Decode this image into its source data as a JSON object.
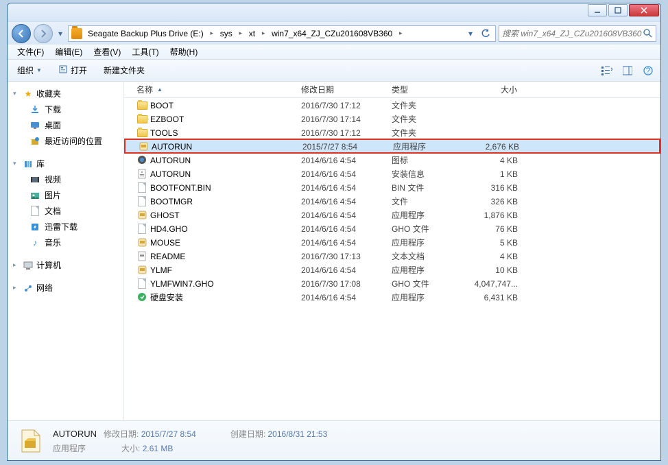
{
  "breadcrumbs": [
    "Seagate Backup Plus Drive (E:)",
    "sys",
    "xt",
    "win7_x64_ZJ_CZu201608VB360"
  ],
  "search_placeholder": "搜索 win7_x64_ZJ_CZu201608VB360",
  "menu": {
    "file": "文件(F)",
    "edit": "编辑(E)",
    "view": "查看(V)",
    "tools": "工具(T)",
    "help": "帮助(H)"
  },
  "toolbar": {
    "organize": "组织",
    "open": "打开",
    "newfolder": "新建文件夹"
  },
  "columns": {
    "name": "名称",
    "date": "修改日期",
    "type": "类型",
    "size": "大小"
  },
  "sidebar": {
    "fav": {
      "label": "收藏夹",
      "items": [
        "下载",
        "桌面",
        "最近访问的位置"
      ]
    },
    "lib": {
      "label": "库",
      "items": [
        "视频",
        "图片",
        "文档",
        "迅雷下载",
        "音乐"
      ]
    },
    "computer": "计算机",
    "network": "网络"
  },
  "files": [
    {
      "icon": "folder",
      "name": "BOOT",
      "date": "2016/7/30 17:12",
      "type": "文件夹",
      "size": ""
    },
    {
      "icon": "folder",
      "name": "EZBOOT",
      "date": "2016/7/30 17:14",
      "type": "文件夹",
      "size": ""
    },
    {
      "icon": "folder",
      "name": "TOOLS",
      "date": "2016/7/30 17:12",
      "type": "文件夹",
      "size": ""
    },
    {
      "icon": "exe",
      "name": "AUTORUN",
      "date": "2015/7/27 8:54",
      "type": "应用程序",
      "size": "2,676 KB",
      "selected": true,
      "highlighted": true
    },
    {
      "icon": "ico",
      "name": "AUTORUN",
      "date": "2014/6/16 4:54",
      "type": "图标",
      "size": "4 KB"
    },
    {
      "icon": "inf",
      "name": "AUTORUN",
      "date": "2014/6/16 4:54",
      "type": "安装信息",
      "size": "1 KB"
    },
    {
      "icon": "file",
      "name": "BOOTFONT.BIN",
      "date": "2014/6/16 4:54",
      "type": "BIN 文件",
      "size": "316 KB"
    },
    {
      "icon": "file",
      "name": "BOOTMGR",
      "date": "2014/6/16 4:54",
      "type": "文件",
      "size": "326 KB"
    },
    {
      "icon": "exe",
      "name": "GHOST",
      "date": "2014/6/16 4:54",
      "type": "应用程序",
      "size": "1,876 KB"
    },
    {
      "icon": "file",
      "name": "HD4.GHO",
      "date": "2014/6/16 4:54",
      "type": "GHO 文件",
      "size": "76 KB"
    },
    {
      "icon": "exe",
      "name": "MOUSE",
      "date": "2014/6/16 4:54",
      "type": "应用程序",
      "size": "5 KB"
    },
    {
      "icon": "txt",
      "name": "README",
      "date": "2016/7/30 17:13",
      "type": "文本文档",
      "size": "4 KB"
    },
    {
      "icon": "exe",
      "name": "YLMF",
      "date": "2014/6/16 4:54",
      "type": "应用程序",
      "size": "10 KB"
    },
    {
      "icon": "file",
      "name": "YLMFWIN7.GHO",
      "date": "2016/7/30 17:08",
      "type": "GHO 文件",
      "size": "4,047,747..."
    },
    {
      "icon": "exe-g",
      "name": "硬盘安装",
      "date": "2014/6/16 4:54",
      "type": "应用程序",
      "size": "6,431 KB"
    }
  ],
  "details": {
    "name": "AUTORUN",
    "type": "应用程序",
    "mod_lbl": "修改日期:",
    "mod_val": "2015/7/27 8:54",
    "create_lbl": "创建日期:",
    "create_val": "2016/8/31 21:53",
    "size_lbl": "大小:",
    "size_val": "2.61 MB"
  }
}
